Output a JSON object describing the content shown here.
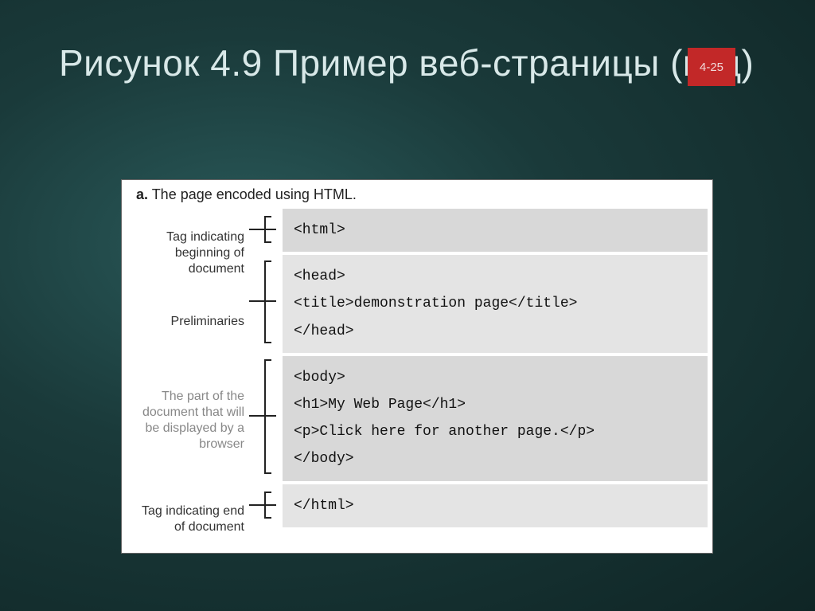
{
  "slide": {
    "title": "Рисунок 4.9  Пример веб-страницы (код)",
    "number": "4-25"
  },
  "figure": {
    "caption_label": "a.",
    "caption_text": " The page encoded using HTML.",
    "annotations": [
      {
        "label": "Tag indicating beginning of document",
        "gray": false
      },
      {
        "label": "Preliminaries",
        "gray": false
      },
      {
        "label": "The part of the document that will be displayed by a browser",
        "gray": true
      },
      {
        "label": "Tag indicating end of document",
        "gray": false
      }
    ],
    "code": {
      "block1": {
        "line1": "<html>"
      },
      "block2": {
        "line1": "<head>",
        "line2": "<title>demonstration page</title>",
        "line3": "</head>"
      },
      "block3": {
        "line1": "<body>",
        "line2": "<h1>My Web Page</h1>",
        "line3": "<p>Click here for another page.</p>",
        "line4": "</body>"
      },
      "block4": {
        "line1": "</html>"
      }
    }
  }
}
